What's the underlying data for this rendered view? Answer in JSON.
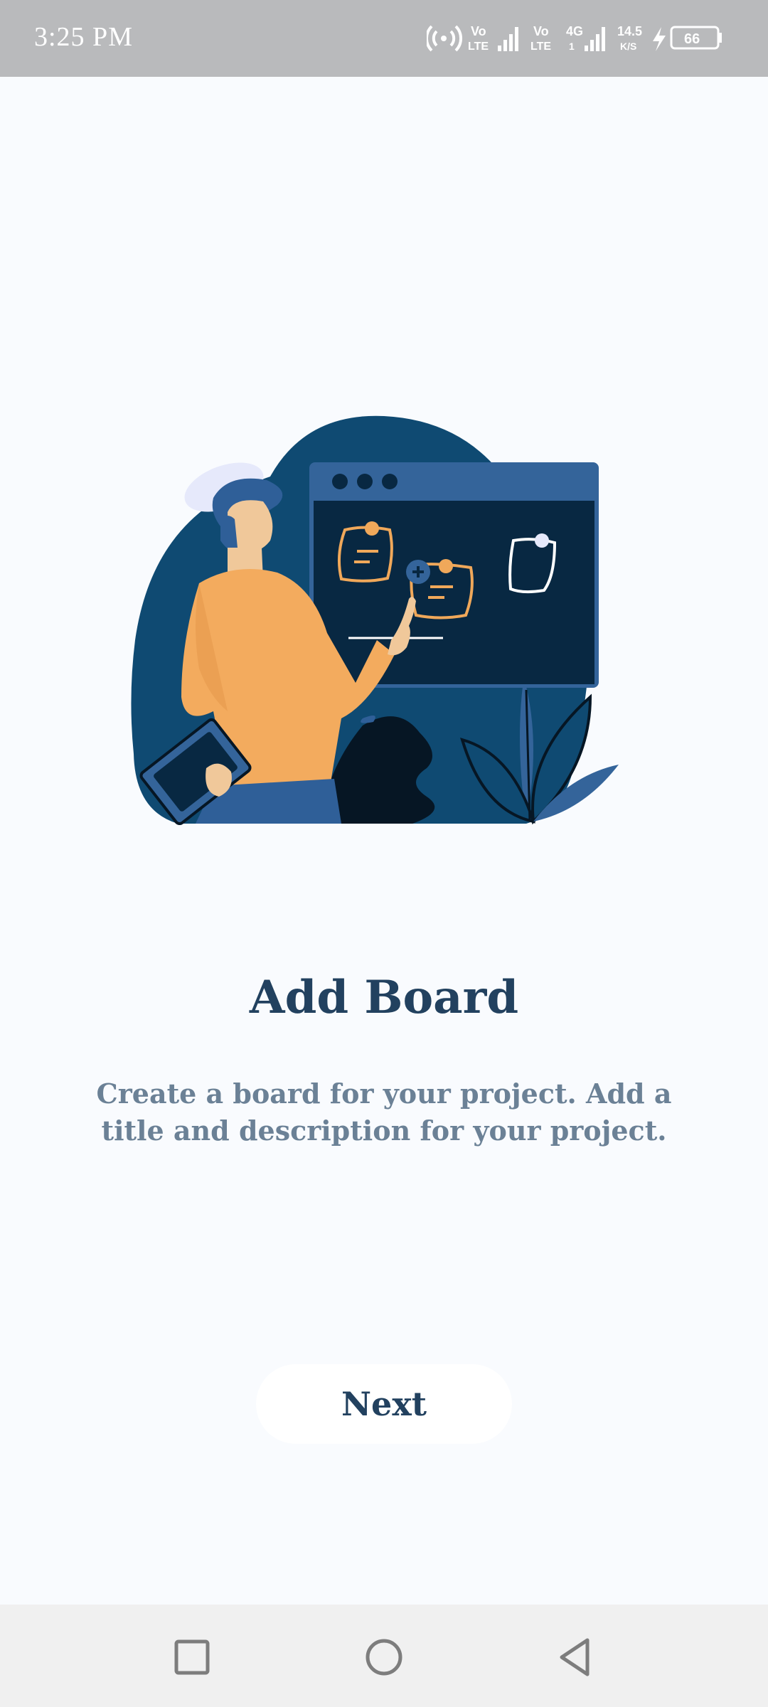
{
  "status_bar": {
    "time": "3:25 PM",
    "volte1": [
      "Vo",
      "LTE"
    ],
    "volte2": [
      "Vo",
      "LTE"
    ],
    "network": [
      "4G",
      "1"
    ],
    "speed": [
      "14.5",
      "K/S"
    ],
    "battery": "66",
    "icons": [
      "hotspot-icon",
      "signal-icon",
      "charging-icon",
      "battery-icon"
    ]
  },
  "illustration": {
    "icon": "presenter-board-illustration",
    "colors": {
      "blob": "#0f4a72",
      "board_frame": "#34649a",
      "board_screen": "#082842",
      "sweater": "#f3ab5e",
      "skin": "#f0c89a",
      "hair": "#2f5f98",
      "note_outline": "#f0a85a"
    }
  },
  "content": {
    "title": "Add Board",
    "description": "Create a board for your project. Add a title and description for your project."
  },
  "actions": {
    "next_label": "Next"
  },
  "nav_bar": {
    "icons": [
      "recents-square-icon",
      "home-circle-icon",
      "back-triangle-icon"
    ]
  },
  "theme": {
    "background": "#f9fbfe",
    "title_color": "#22415f",
    "description_color": "#6b8196",
    "status_bar_bg": "#b9babc",
    "nav_bar_bg": "#f0f0f0"
  }
}
